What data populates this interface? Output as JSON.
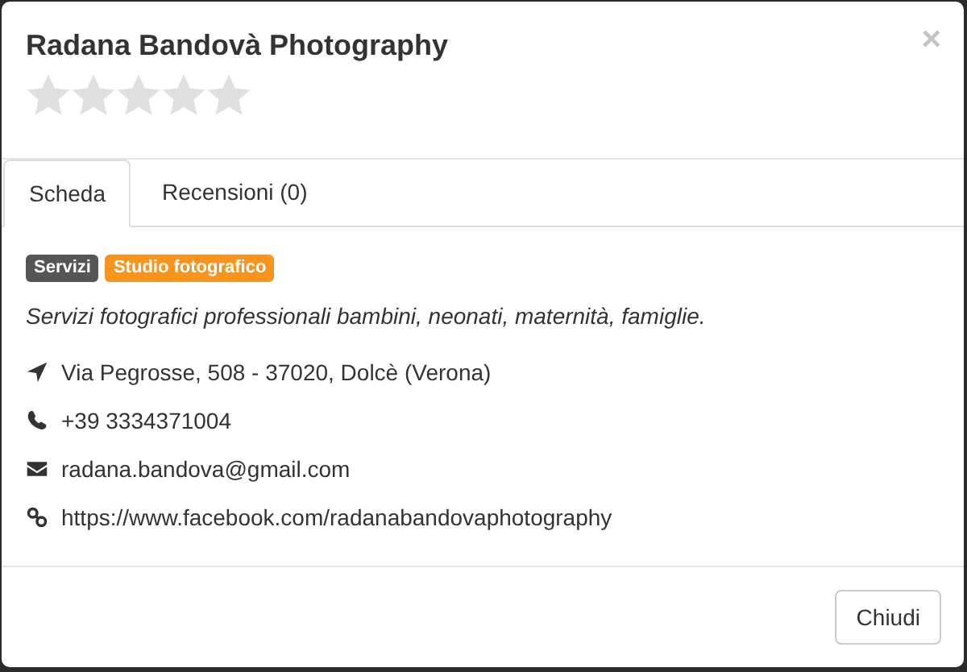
{
  "modal": {
    "title": "Radana Bandovà Photography",
    "stars": 0,
    "close": "×"
  },
  "tabs": [
    {
      "label": "Scheda",
      "selected": true
    },
    {
      "label": "Recensioni (0)",
      "selected": false
    }
  ],
  "badges": [
    {
      "label": "Servizi",
      "color": "#555555"
    },
    {
      "label": "Studio fotografico",
      "color": "#f7941d"
    }
  ],
  "description": "Servizi fotografici professionali bambini, neonati, maternità, famiglie.",
  "contacts": [
    {
      "kind": "address",
      "text": "Via Pegrosse, 508 - 37020, Dolcè (Verona)"
    },
    {
      "kind": "phone",
      "text": "+39 3334371004"
    },
    {
      "kind": "email",
      "text": "radana.bandova@gmail.com"
    },
    {
      "kind": "link",
      "text": "https://www.facebook.com/radanabandovaphotography"
    }
  ],
  "footer": {
    "button": "Chiudi"
  }
}
